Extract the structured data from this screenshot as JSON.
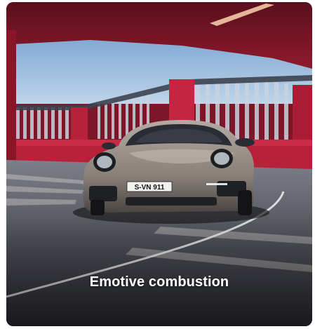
{
  "card": {
    "title": "Emotive combustion",
    "image": {
      "subject": "sports-car-photo",
      "plate_text": "S-VN 911"
    }
  },
  "colors": {
    "card_bg": "#3a3b40",
    "wall_red": "#b8213a",
    "sky": "#a9c7e6",
    "caption": "#ffffff"
  }
}
